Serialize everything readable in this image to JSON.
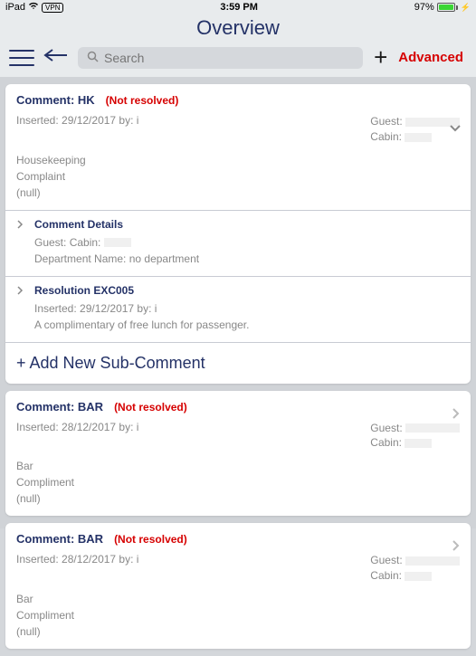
{
  "status": {
    "device": "iPad",
    "vpn": "VPN",
    "time": "3:59 PM",
    "battery_pct": "97%"
  },
  "header": {
    "title": "Overview",
    "search_placeholder": "Search",
    "advanced": "Advanced"
  },
  "comments": [
    {
      "title": "Comment: HK",
      "status": "(Not resolved)",
      "inserted": "Inserted: 29/12/2017 by: i",
      "guest_label": "Guest:",
      "cabin_label": "Cabin:",
      "tag1": "Housekeeping",
      "tag2": "Complaint",
      "tag3": "(null)",
      "expanded": true,
      "details": {
        "title": "Comment Details",
        "guest_label": "Guest:",
        "cabin_label": "Cabin:",
        "dept": "Department Name: no department"
      },
      "resolution": {
        "title": "Resolution EXC005",
        "inserted": "Inserted: 29/12/2017 by: i",
        "text": "A complimentary of free lunch for passenger."
      },
      "add_new": "+ Add New Sub-Comment"
    },
    {
      "title": "Comment: BAR",
      "status": "(Not resolved)",
      "inserted": "Inserted: 28/12/2017 by: i",
      "guest_label": "Guest:",
      "cabin_label": "Cabin:",
      "tag1": "Bar",
      "tag2": "Compliment",
      "tag3": "(null)"
    },
    {
      "title": "Comment: BAR",
      "status": "(Not resolved)",
      "inserted": "Inserted: 28/12/2017 by: i",
      "guest_label": "Guest:",
      "cabin_label": "Cabin:",
      "tag1": "Bar",
      "tag2": "Compliment",
      "tag3": "(null)"
    }
  ]
}
